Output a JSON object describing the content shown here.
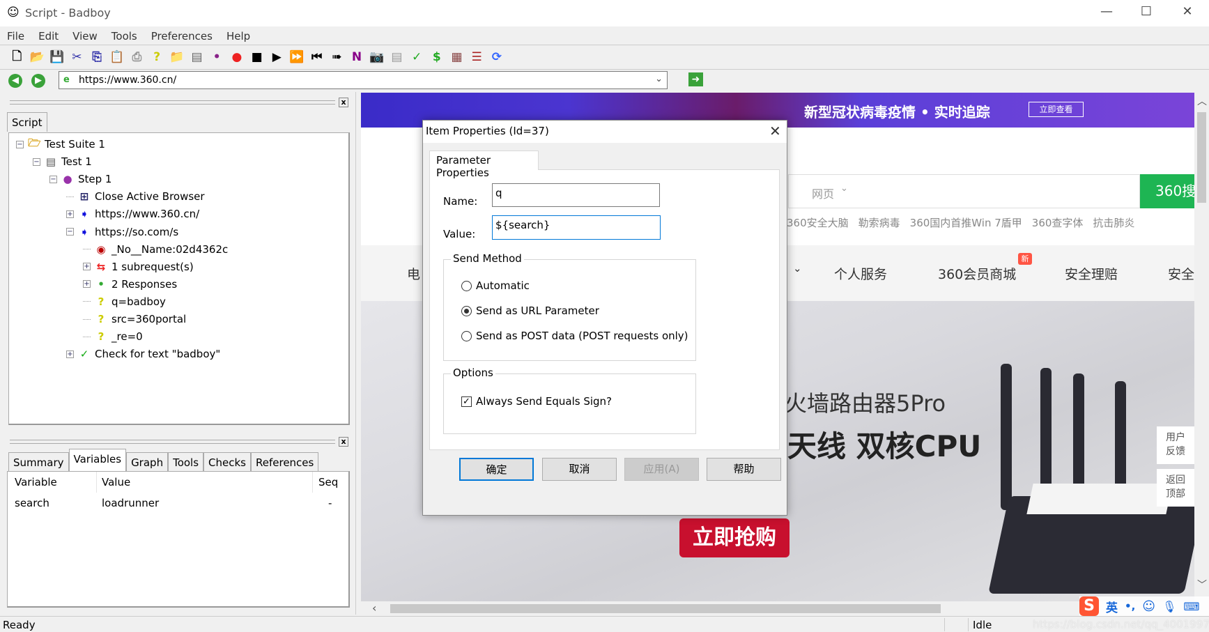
{
  "window": {
    "title": "Script - Badboy",
    "controls": [
      "—",
      "☐",
      "✕"
    ]
  },
  "menu": [
    "File",
    "Edit",
    "View",
    "Tools",
    "Preferences",
    "Help"
  ],
  "toolbar": [
    {
      "icon": "new-icon",
      "glyph": "🗋",
      "color": "#000"
    },
    {
      "icon": "open-icon",
      "glyph": "📂",
      "color": "#c90"
    },
    {
      "icon": "save-icon",
      "glyph": "💾",
      "color": "#333"
    },
    {
      "icon": "cut-icon",
      "glyph": "✂",
      "color": "#33a"
    },
    {
      "icon": "copy-icon",
      "glyph": "⎘",
      "color": "#33a"
    },
    {
      "icon": "paste-icon",
      "glyph": "📋",
      "color": "#555"
    },
    {
      "icon": "print-icon",
      "glyph": "⎙",
      "color": "#999"
    },
    {
      "icon": "help-icon",
      "glyph": "?",
      "color": "#cc0"
    },
    {
      "icon": "add-suite-icon",
      "glyph": "📁",
      "color": "#eb5"
    },
    {
      "icon": "add-test-icon",
      "glyph": "▤",
      "color": "#666"
    },
    {
      "icon": "add-step-icon",
      "glyph": "•",
      "color": "#828"
    },
    {
      "icon": "record-icon",
      "glyph": "●",
      "color": "#e22"
    },
    {
      "icon": "stop-icon",
      "glyph": "■",
      "color": "#000"
    },
    {
      "icon": "play-icon",
      "glyph": "▶",
      "color": "#000"
    },
    {
      "icon": "play-all-icon",
      "glyph": "⏩",
      "color": "#000"
    },
    {
      "icon": "rewind-icon",
      "glyph": "⏮",
      "color": "#000"
    },
    {
      "icon": "step-forward-icon",
      "glyph": "➠",
      "color": "#000"
    },
    {
      "icon": "n-icon",
      "glyph": "N",
      "color": "#808"
    },
    {
      "icon": "camera-icon",
      "glyph": "📷",
      "color": "#333"
    },
    {
      "icon": "page-icon",
      "glyph": "▤",
      "color": "#999"
    },
    {
      "icon": "check-icon",
      "glyph": "✓",
      "color": "#2a2"
    },
    {
      "icon": "variable-icon",
      "glyph": "$",
      "color": "#2a2"
    },
    {
      "icon": "table-icon",
      "glyph": "▦",
      "color": "#844"
    },
    {
      "icon": "report-icon",
      "glyph": "☰",
      "color": "#a22"
    },
    {
      "icon": "refresh-icon",
      "glyph": "⟳",
      "color": "#36f"
    }
  ],
  "address": {
    "url": "https://www.360.cn/"
  },
  "script_panel": {
    "tab": "Script"
  },
  "tree": [
    {
      "level": 0,
      "toggle": "−",
      "icon": "folder-icon",
      "glyph": "🗁",
      "color": "#d9a520",
      "label": "Test Suite 1"
    },
    {
      "level": 1,
      "toggle": "−",
      "icon": "test-icon",
      "glyph": "▤",
      "color": "#555",
      "label": "Test 1"
    },
    {
      "level": 2,
      "toggle": "−",
      "icon": "step-icon",
      "glyph": "●",
      "color": "#93a",
      "label": "Step 1"
    },
    {
      "level": 3,
      "toggle": "",
      "icon": "browser-icon",
      "glyph": "⊞",
      "color": "#226",
      "label": "Close Active Browser"
    },
    {
      "level": 3,
      "toggle": "+",
      "icon": "request-icon",
      "glyph": "➧",
      "color": "#11d",
      "label": "https://www.360.cn/"
    },
    {
      "level": 3,
      "toggle": "−",
      "icon": "request-icon",
      "glyph": "➧",
      "color": "#11d",
      "label": "https://so.com/s"
    },
    {
      "level": 4,
      "toggle": "",
      "icon": "form-icon",
      "glyph": "◉",
      "color": "#b00",
      "label": "_No__Name:02d4362c"
    },
    {
      "level": 4,
      "toggle": "+",
      "icon": "subrequest-icon",
      "glyph": "⇆",
      "color": "#e22",
      "label": "1 subrequest(s)"
    },
    {
      "level": 4,
      "toggle": "+",
      "icon": "response-icon",
      "glyph": "•",
      "color": "#3a3",
      "label": "2 Responses"
    },
    {
      "level": 4,
      "toggle": "",
      "icon": "parameter-icon",
      "glyph": "?",
      "color": "#cc0",
      "label": "q=badboy"
    },
    {
      "level": 4,
      "toggle": "",
      "icon": "parameter-icon",
      "glyph": "?",
      "color": "#cc0",
      "label": "src=360portal"
    },
    {
      "level": 4,
      "toggle": "",
      "icon": "parameter-icon",
      "glyph": "?",
      "color": "#cc0",
      "label": "_re=0"
    },
    {
      "level": 3,
      "toggle": "+",
      "icon": "check-icon",
      "glyph": "✓",
      "color": "#1a1",
      "label": "Check for text \"badboy\""
    }
  ],
  "bottom_tabs": [
    "Summary",
    "Variables",
    "Graph",
    "Tools",
    "Checks",
    "References"
  ],
  "bottom_active": "Variables",
  "variables": {
    "columns": [
      "Variable",
      "Value",
      "Seq"
    ],
    "rows": [
      [
        "search",
        "loadrunner",
        "-"
      ]
    ]
  },
  "status": {
    "left": "Ready",
    "right": "Idle"
  },
  "webpage": {
    "banner": "新型冠状病毒疫情 • 实时追踪",
    "banner_button": "立即查看",
    "search_type": "网页",
    "search_button": "360搜",
    "hot_words": [
      "360安全大脑",
      "勒索病毒",
      "360国内首推Win 7盾甲",
      "360查字体",
      "抗击肺炎"
    ],
    "nav": [
      "电",
      "个人服务",
      "360会员商城",
      "安全理赔",
      "安全"
    ],
    "new_badge": "新",
    "hero_line1": "火墙路由器5Pro",
    "hero_line2": "天线 双核CPU",
    "buy_button": "立即抢购",
    "side_feedback": "用户反馈",
    "side_top": "返回顶部",
    "banner_color": "#6a3fd8",
    "search_green": "#1eb553",
    "buy_red": "#c8102e"
  },
  "dialog": {
    "title": "Item Properties (Id=37)",
    "tab": "Parameter Properties",
    "name_label": "Name:",
    "name_value": "q",
    "value_label": "Value:",
    "value_value": "${search}",
    "send_method_label": "Send Method",
    "send_methods": [
      {
        "label": "Automatic",
        "selected": false
      },
      {
        "label": "Send as URL Parameter",
        "selected": true
      },
      {
        "label": "Send as POST data (POST requests only)",
        "selected": false
      }
    ],
    "options_label": "Options",
    "always_equals_label": "Always Send Equals Sign?",
    "always_equals_checked": true,
    "ok": "确定",
    "cancel": "取消",
    "apply": "应用(A)",
    "help": "帮助"
  },
  "ime": {
    "logo": "S",
    "lang": "英",
    "punct": "•,"
  },
  "watermark": "https://blog.csdn.net/qq_40019973"
}
